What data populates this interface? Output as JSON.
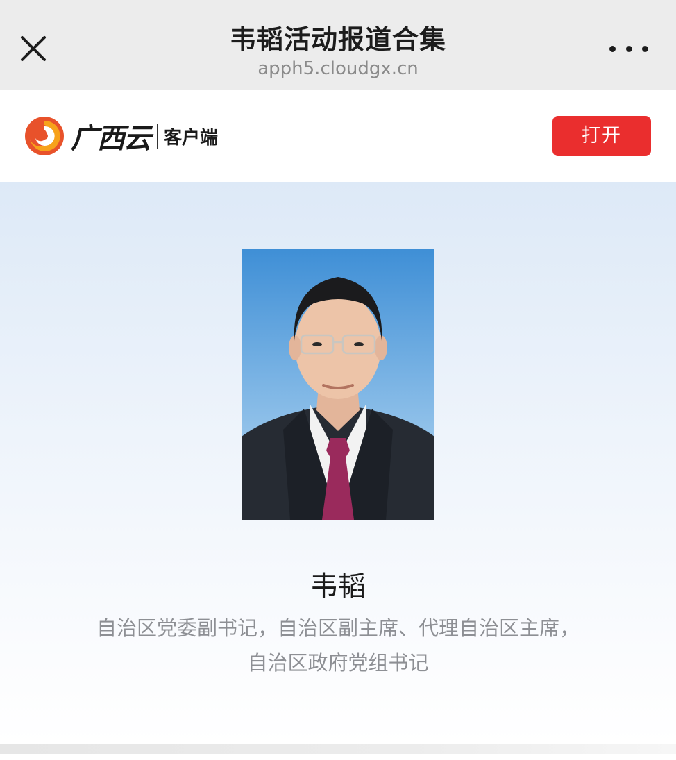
{
  "navbar": {
    "title": "韦韬活动报道合集",
    "url": "apph5.cloudgx.cn",
    "close_icon": "close-icon",
    "more_icon": "more-dots-icon"
  },
  "app_banner": {
    "logo_text": "广西云",
    "logo_sub": "客户端",
    "open_label": "打开",
    "open_color": "#ea2e2e"
  },
  "profile": {
    "name": "韦韬",
    "title_line1": "自治区党委副书记，自治区副主席、代理自治区主席，",
    "title_line2": "自治区政府党组书记"
  }
}
